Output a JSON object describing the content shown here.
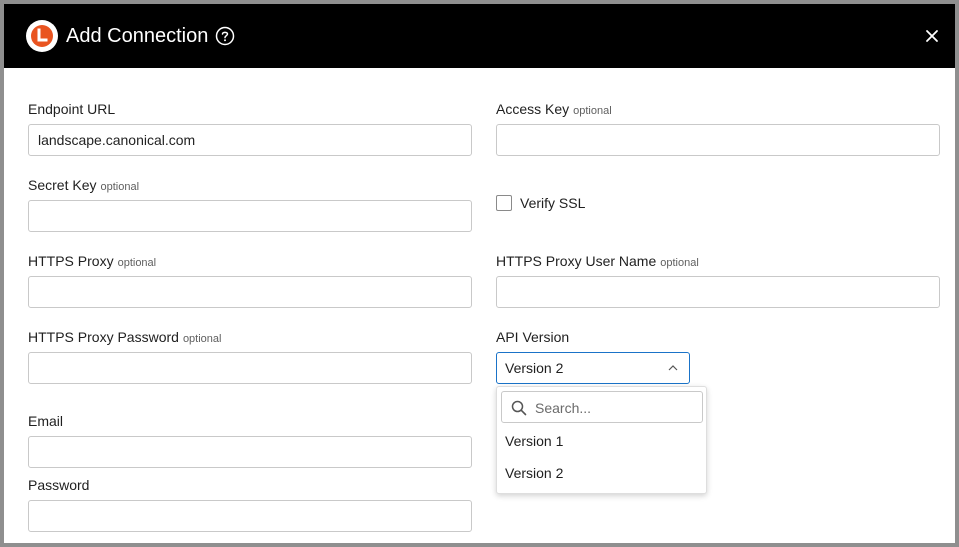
{
  "dialog": {
    "title": "Add Connection",
    "logo_icon": "landscape-logo-icon",
    "help_icon": "help-circle-icon",
    "close_icon": "close-icon",
    "brand_color": "#e95420"
  },
  "form": {
    "optional_tag": "optional",
    "endpoint_url": {
      "label": "Endpoint URL",
      "value": "landscape.canonical.com"
    },
    "access_key": {
      "label": "Access Key",
      "value": ""
    },
    "secret_key": {
      "label": "Secret Key",
      "value": ""
    },
    "verify_ssl": {
      "label": "Verify SSL",
      "checked": false
    },
    "https_proxy": {
      "label": "HTTPS Proxy",
      "value": ""
    },
    "https_proxy_user": {
      "label": "HTTPS Proxy User Name",
      "value": ""
    },
    "https_proxy_password": {
      "label": "HTTPS Proxy Password",
      "value": ""
    },
    "api_version": {
      "label": "API Version",
      "value": "Version 2",
      "search_placeholder": "Search...",
      "options": [
        "Version 1",
        "Version 2"
      ]
    },
    "email": {
      "label": "Email",
      "value": ""
    },
    "password": {
      "label": "Password",
      "value": ""
    }
  }
}
